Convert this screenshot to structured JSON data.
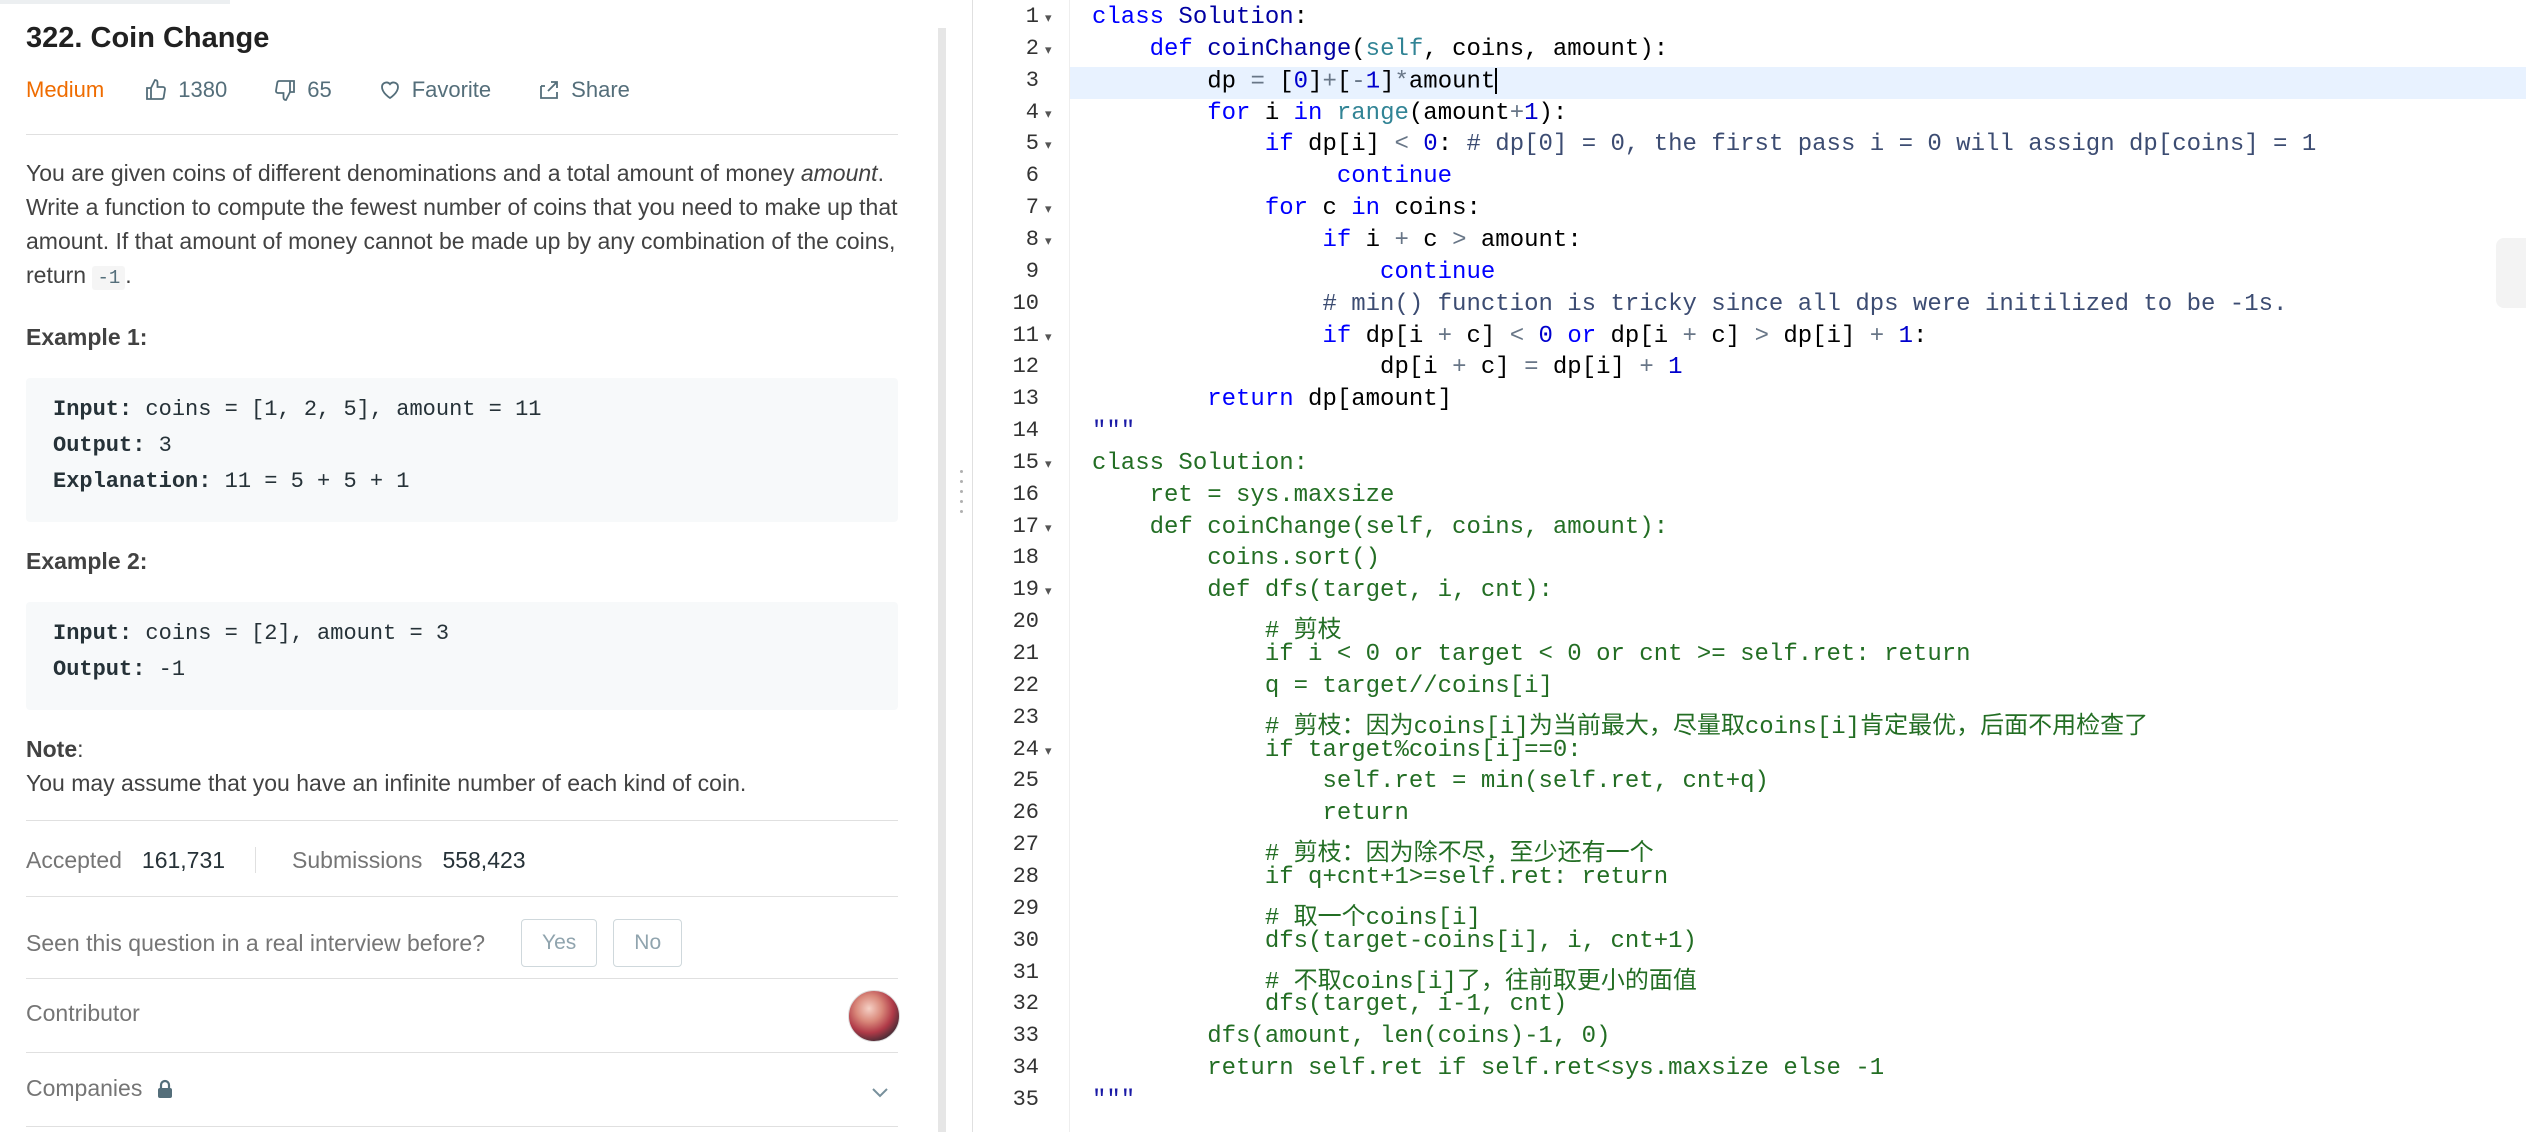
{
  "problem": {
    "title": "322. Coin Change",
    "difficulty": "Medium",
    "likes": "1380",
    "dislikes": "65",
    "favorite_label": "Favorite",
    "share_label": "Share"
  },
  "description": {
    "p1": "You are given coins of different denominations and a total amount of money ",
    "p_em": "amount",
    "p2": ". Write a function to compute the fewest number of coins that you need to make up that amount. If that amount of money cannot be made up by any combination of the coins, return ",
    "p_code": "-1",
    "p3": "."
  },
  "examples": [
    {
      "label": "Example 1:",
      "input_key": "Input:",
      "input": " coins = [1, 2, 5], amount = 11",
      "output_key": "Output:",
      "output": " 3",
      "expl_key": "Explanation:",
      "expl": " 11 = 5 + 5 + 1"
    },
    {
      "label": "Example 2:",
      "input_key": "Input:",
      "input": " coins = [2], amount = 3",
      "output_key": "Output:",
      "output": " -1"
    }
  ],
  "note": {
    "label": "Note",
    "colon": ":",
    "text": "You may assume that you have an infinite number of each kind of coin."
  },
  "stats": {
    "accepted_label": "Accepted",
    "accepted": "161,731",
    "submissions_label": "Submissions",
    "submissions": "558,423"
  },
  "interview": {
    "question": "Seen this question in a real interview before?",
    "yes": "Yes",
    "no": "No"
  },
  "contributor_label": "Contributor",
  "companies_label": "Companies",
  "editor": {
    "line_numbers": [
      "1",
      "2",
      "3",
      "4",
      "5",
      "6",
      "7",
      "8",
      "9",
      "10",
      "11",
      "12",
      "13",
      "14",
      "15",
      "16",
      "17",
      "18",
      "19",
      "20",
      "21",
      "22",
      "23",
      "24",
      "25",
      "26",
      "27",
      "28",
      "29",
      "30",
      "31",
      "32",
      "33",
      "34",
      "35"
    ],
    "fold_lines": [
      1,
      2,
      4,
      5,
      7,
      8,
      11,
      15,
      17,
      19,
      24
    ],
    "current_line": 3,
    "lines": [
      [
        [
          "kw",
          "class"
        ],
        [
          "id",
          " "
        ],
        [
          "fn",
          "Solution"
        ],
        [
          "id",
          ":"
        ]
      ],
      [
        [
          "id",
          "    "
        ],
        [
          "kw",
          "def"
        ],
        [
          "id",
          " "
        ],
        [
          "fn",
          "coinChange"
        ],
        [
          "id",
          "("
        ],
        [
          "self",
          "self"
        ],
        [
          "id",
          ", coins, amount):"
        ]
      ],
      [
        [
          "id",
          "        dp "
        ],
        [
          "op",
          "="
        ],
        [
          "id",
          " ["
        ],
        [
          "num",
          "0"
        ],
        [
          "id",
          "]"
        ],
        [
          "op",
          "+"
        ],
        [
          "id",
          "["
        ],
        [
          "op",
          "-"
        ],
        [
          "num",
          "1"
        ],
        [
          "id",
          "]"
        ],
        [
          "op",
          "*"
        ],
        [
          "id",
          "amount"
        ],
        [
          "cursor",
          ""
        ]
      ],
      [
        [
          "id",
          "        "
        ],
        [
          "kw",
          "for"
        ],
        [
          "id",
          " i "
        ],
        [
          "kw",
          "in"
        ],
        [
          "id",
          " "
        ],
        [
          "self",
          "range"
        ],
        [
          "id",
          "(amount"
        ],
        [
          "op",
          "+"
        ],
        [
          "num",
          "1"
        ],
        [
          "id",
          "):"
        ]
      ],
      [
        [
          "id",
          "            "
        ],
        [
          "kw",
          "if"
        ],
        [
          "id",
          " dp[i] "
        ],
        [
          "op",
          "<"
        ],
        [
          "id",
          " "
        ],
        [
          "num",
          "0"
        ],
        [
          "id",
          ": "
        ],
        [
          "bl",
          "# dp[0] = 0, the first pass i = 0 will assign dp[coins] = 1"
        ]
      ],
      [
        [
          "id",
          "                 "
        ],
        [
          "kw",
          "continue"
        ]
      ],
      [
        [
          "id",
          "            "
        ],
        [
          "kw",
          "for"
        ],
        [
          "id",
          " c "
        ],
        [
          "kw",
          "in"
        ],
        [
          "id",
          " coins:"
        ]
      ],
      [
        [
          "id",
          "                "
        ],
        [
          "kw",
          "if"
        ],
        [
          "id",
          " i "
        ],
        [
          "op",
          "+"
        ],
        [
          "id",
          " c "
        ],
        [
          "op",
          ">"
        ],
        [
          "id",
          " amount:"
        ]
      ],
      [
        [
          "id",
          "                    "
        ],
        [
          "kw",
          "continue"
        ]
      ],
      [
        [
          "id",
          "                "
        ],
        [
          "bl",
          "# min() function is tricky since all dps were initilized to be -1s."
        ]
      ],
      [
        [
          "id",
          "                "
        ],
        [
          "kw",
          "if"
        ],
        [
          "id",
          " dp[i "
        ],
        [
          "op",
          "+"
        ],
        [
          "id",
          " c] "
        ],
        [
          "op",
          "<"
        ],
        [
          "id",
          " "
        ],
        [
          "num",
          "0"
        ],
        [
          "id",
          " "
        ],
        [
          "kw",
          "or"
        ],
        [
          "id",
          " dp[i "
        ],
        [
          "op",
          "+"
        ],
        [
          "id",
          " c] "
        ],
        [
          "op",
          ">"
        ],
        [
          "id",
          " dp[i] "
        ],
        [
          "op",
          "+"
        ],
        [
          "id",
          " "
        ],
        [
          "num",
          "1"
        ],
        [
          "id",
          ":"
        ]
      ],
      [
        [
          "id",
          "                    dp[i "
        ],
        [
          "op",
          "+"
        ],
        [
          "id",
          " c] "
        ],
        [
          "op",
          "="
        ],
        [
          "id",
          " dp[i] "
        ],
        [
          "op",
          "+"
        ],
        [
          "id",
          " "
        ],
        [
          "num",
          "1"
        ]
      ],
      [
        [
          "id",
          "        "
        ],
        [
          "kw",
          "return"
        ],
        [
          "id",
          " dp[amount]"
        ]
      ],
      [
        [
          "str",
          "\"\"\""
        ]
      ],
      [
        [
          "green",
          "class Solution:"
        ]
      ],
      [
        [
          "green",
          "    ret = sys.maxsize"
        ]
      ],
      [
        [
          "green",
          "    def coinChange(self, coins, amount):"
        ]
      ],
      [
        [
          "green",
          "        coins.sort()"
        ]
      ],
      [
        [
          "green",
          "        def dfs(target, i, cnt):"
        ]
      ],
      [
        [
          "green",
          "            # 剪枝"
        ]
      ],
      [
        [
          "green",
          "            if i < 0 or target < 0 or cnt >= self.ret: return"
        ]
      ],
      [
        [
          "green",
          "            q = target//coins[i]"
        ]
      ],
      [
        [
          "green",
          "            # 剪枝：因为coins[i]为当前最大，尽量取coins[i]肯定最优，后面不用检查了"
        ]
      ],
      [
        [
          "green",
          "            if target%coins[i]==0:"
        ]
      ],
      [
        [
          "green",
          "                self.ret = min(self.ret, cnt+q)"
        ]
      ],
      [
        [
          "green",
          "                return"
        ]
      ],
      [
        [
          "green",
          "            # 剪枝：因为除不尽，至少还有一个"
        ]
      ],
      [
        [
          "green",
          "            if q+cnt+1>=self.ret: return"
        ]
      ],
      [
        [
          "green",
          "            # 取一个coins[i]"
        ]
      ],
      [
        [
          "green",
          "            dfs(target-coins[i], i, cnt+1)"
        ]
      ],
      [
        [
          "green",
          "            # 不取coins[i]了，往前取更小的面值"
        ]
      ],
      [
        [
          "green",
          "            dfs(target, i-1, cnt)"
        ]
      ],
      [
        [
          "green",
          "        dfs(amount, len(coins)-1, 0)"
        ]
      ],
      [
        [
          "green",
          "        return self.ret if self.ret<sys.maxsize else -1"
        ]
      ],
      [
        [
          "str",
          "\"\"\""
        ]
      ]
    ]
  }
}
